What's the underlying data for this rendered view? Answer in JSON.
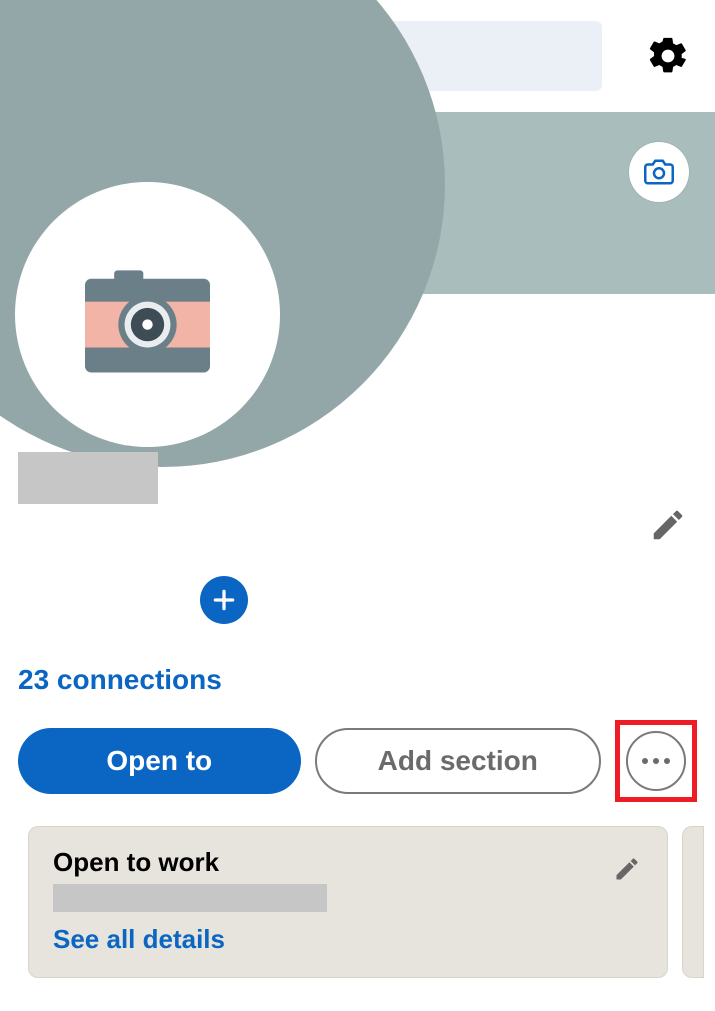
{
  "header": {
    "search_value": ""
  },
  "profile": {
    "name": "",
    "connections_label": "23 connections"
  },
  "actions": {
    "open_to_label": "Open to",
    "add_section_label": "Add section"
  },
  "open_to_work_card": {
    "title": "Open to work",
    "roles": "",
    "see_all_label": "See all details"
  },
  "icons": {
    "back": "back-arrow-icon",
    "search": "search-icon",
    "settings": "gear-icon",
    "edit_cover": "camera-icon",
    "avatar_placeholder": "camera-illustration-icon",
    "add_photo": "plus-icon",
    "edit_profile": "pencil-icon",
    "more": "more-horizontal-icon",
    "edit_card": "pencil-icon"
  },
  "colors": {
    "brand_blue": "#0a66c2",
    "highlight_red": "#ee1c25",
    "cover_bg": "#a9bdbd",
    "cover_blob": "#93a7a8",
    "card_bg": "#e6e4dc"
  }
}
